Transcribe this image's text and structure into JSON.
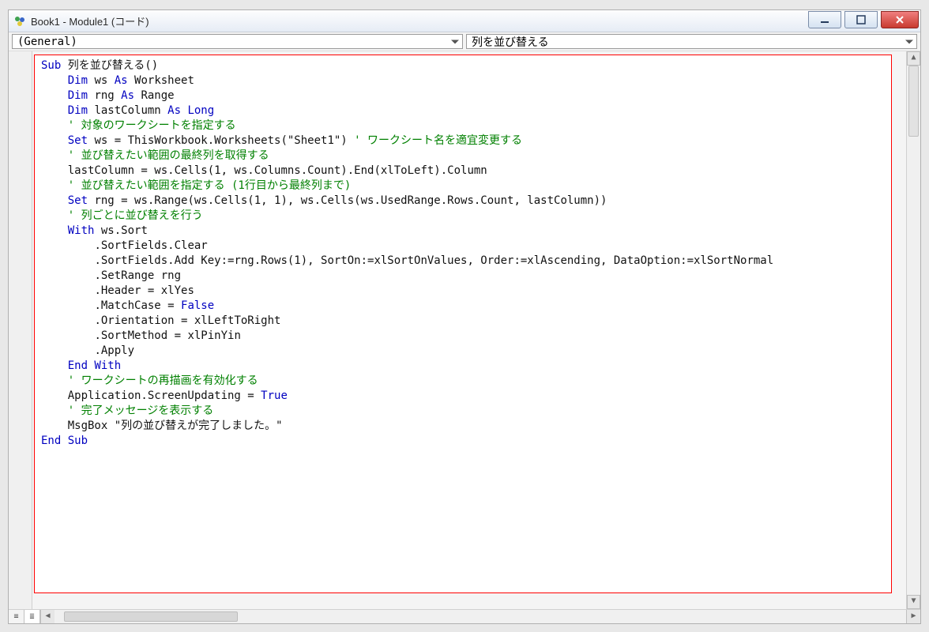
{
  "window": {
    "title": "Book1 - Module1 (コード)"
  },
  "dropdowns": {
    "left": "(General)",
    "right": "列を並び替える"
  },
  "code": {
    "lines": [
      {
        "indent": 0,
        "segs": [
          {
            "t": "Sub ",
            "c": "kw"
          },
          {
            "t": "列を並び替える()"
          }
        ]
      },
      {
        "indent": 1,
        "segs": [
          {
            "t": "Dim ",
            "c": "kw"
          },
          {
            "t": "ws "
          },
          {
            "t": "As ",
            "c": "kw"
          },
          {
            "t": "Worksheet"
          }
        ]
      },
      {
        "indent": 1,
        "segs": [
          {
            "t": "Dim ",
            "c": "kw"
          },
          {
            "t": "rng "
          },
          {
            "t": "As ",
            "c": "kw"
          },
          {
            "t": "Range"
          }
        ]
      },
      {
        "indent": 1,
        "segs": [
          {
            "t": "Dim ",
            "c": "kw"
          },
          {
            "t": "lastColumn "
          },
          {
            "t": "As Long",
            "c": "kw"
          }
        ]
      },
      {
        "indent": 0,
        "segs": [
          {
            "t": ""
          }
        ]
      },
      {
        "indent": 1,
        "segs": [
          {
            "t": "' 対象のワークシートを指定する",
            "c": "cm"
          }
        ]
      },
      {
        "indent": 1,
        "segs": [
          {
            "t": "Set ",
            "c": "kw"
          },
          {
            "t": "ws = ThisWorkbook.Worksheets(\"Sheet1\") "
          },
          {
            "t": "' ワークシート名を適宜変更する",
            "c": "cm"
          }
        ]
      },
      {
        "indent": 0,
        "segs": [
          {
            "t": ""
          }
        ]
      },
      {
        "indent": 1,
        "segs": [
          {
            "t": "' 並び替えたい範囲の最終列を取得する",
            "c": "cm"
          }
        ]
      },
      {
        "indent": 1,
        "segs": [
          {
            "t": "lastColumn = ws.Cells(1, ws.Columns.Count).End(xlToLeft).Column"
          }
        ]
      },
      {
        "indent": 0,
        "segs": [
          {
            "t": ""
          }
        ]
      },
      {
        "indent": 1,
        "segs": [
          {
            "t": "' 並び替えたい範囲を指定する (1行目から最終列まで)",
            "c": "cm"
          }
        ]
      },
      {
        "indent": 1,
        "segs": [
          {
            "t": "Set ",
            "c": "kw"
          },
          {
            "t": "rng = ws.Range(ws.Cells(1, 1), ws.Cells(ws.UsedRange.Rows.Count, lastColumn))"
          }
        ]
      },
      {
        "indent": 0,
        "segs": [
          {
            "t": ""
          }
        ]
      },
      {
        "indent": 1,
        "segs": [
          {
            "t": "' 列ごとに並び替えを行う",
            "c": "cm"
          }
        ]
      },
      {
        "indent": 1,
        "segs": [
          {
            "t": "With ",
            "c": "kw"
          },
          {
            "t": "ws.Sort"
          }
        ]
      },
      {
        "indent": 2,
        "segs": [
          {
            "t": ".SortFields.Clear"
          }
        ]
      },
      {
        "indent": 2,
        "segs": [
          {
            "t": ".SortFields.Add Key:=rng.Rows(1), SortOn:=xlSortOnValues, Order:=xlAscending, DataOption:=xlSortNormal"
          }
        ]
      },
      {
        "indent": 2,
        "segs": [
          {
            "t": ".SetRange rng"
          }
        ]
      },
      {
        "indent": 2,
        "segs": [
          {
            "t": ".Header = xlYes"
          }
        ]
      },
      {
        "indent": 2,
        "segs": [
          {
            "t": ".MatchCase = "
          },
          {
            "t": "False",
            "c": "kw"
          }
        ]
      },
      {
        "indent": 2,
        "segs": [
          {
            "t": ".Orientation = xlLeftToRight"
          }
        ]
      },
      {
        "indent": 2,
        "segs": [
          {
            "t": ".SortMethod = xlPinYin"
          }
        ]
      },
      {
        "indent": 2,
        "segs": [
          {
            "t": ".Apply"
          }
        ]
      },
      {
        "indent": 1,
        "segs": [
          {
            "t": "End With",
            "c": "kw"
          }
        ]
      },
      {
        "indent": 0,
        "segs": [
          {
            "t": ""
          }
        ]
      },
      {
        "indent": 1,
        "segs": [
          {
            "t": "' ワークシートの再描画を有効化する",
            "c": "cm"
          }
        ]
      },
      {
        "indent": 1,
        "segs": [
          {
            "t": "Application.ScreenUpdating = "
          },
          {
            "t": "True",
            "c": "kw"
          }
        ]
      },
      {
        "indent": 0,
        "segs": [
          {
            "t": ""
          }
        ]
      },
      {
        "indent": 1,
        "segs": [
          {
            "t": "' 完了メッセージを表示する",
            "c": "cm"
          }
        ]
      },
      {
        "indent": 1,
        "segs": [
          {
            "t": "MsgBox \"列の並び替えが完了しました。\""
          }
        ]
      },
      {
        "indent": 0,
        "segs": [
          {
            "t": "End Sub",
            "c": "kw"
          }
        ]
      }
    ]
  }
}
